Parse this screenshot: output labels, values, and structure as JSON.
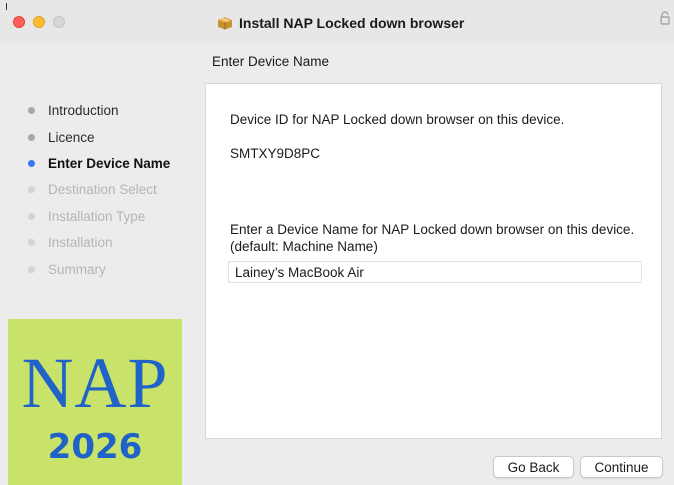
{
  "window": {
    "title": "Install NAP Locked down browser",
    "title_icon": "package-icon",
    "trailing_glyph": "lock-icon"
  },
  "page": {
    "section_title": "Enter Device Name"
  },
  "sidebar": {
    "steps": [
      {
        "label": "Introduction",
        "state": "done"
      },
      {
        "label": "Licence",
        "state": "done"
      },
      {
        "label": "Enter Device Name",
        "state": "current"
      },
      {
        "label": "Destination Select",
        "state": "future"
      },
      {
        "label": "Installation Type",
        "state": "future"
      },
      {
        "label": "Installation",
        "state": "future"
      },
      {
        "label": "Summary",
        "state": "future"
      }
    ]
  },
  "logo": {
    "text": "NAP",
    "year": "2026"
  },
  "content": {
    "device_id_label": "Device ID for NAP Locked down browser on this device.",
    "device_id_value": "SMTXY9D8PC",
    "name_prompt": "Enter a Device Name for NAP Locked down browser on this device. (default: Machine Name)",
    "device_name_value": "Lainey’s MacBook Air"
  },
  "buttons": {
    "go_back": "Go Back",
    "continue": "Continue"
  },
  "colors": {
    "accent_blue": "#3478f6",
    "logo_background": "#c9e26a",
    "logo_text": "#1f63c9",
    "close": "#ff5f57",
    "minimize": "#febc2e"
  }
}
